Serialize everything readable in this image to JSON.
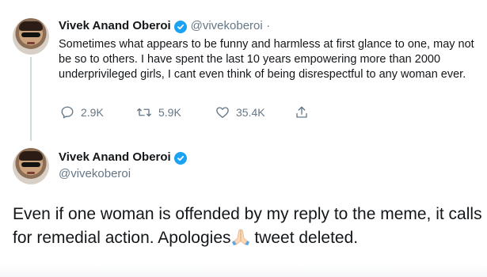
{
  "tweet1": {
    "name": "Vivek Anand Oberoi",
    "handle": "@vivekoberoi",
    "separator": "·",
    "text": "Sometimes what appears to be funny and harmless at first glance to one, may not be so to others. I have spent the last 10 years empowering more than 2000 underprivileged girls, I cant even think of being disrespectful to any woman ever.",
    "actions": {
      "reply_count": "2.9K",
      "retweet_count": "5.9K",
      "like_count": "35.4K"
    }
  },
  "tweet2": {
    "name": "Vivek Anand Oberoi",
    "handle": "@vivekoberoi",
    "text_before": "Even if one woman is offended by my reply to the meme, it calls for remedial action. Apologies",
    "text_after": " tweet deleted."
  },
  "icons": {
    "verified": "verified-badge-icon",
    "reply": "reply-icon",
    "retweet": "retweet-icon",
    "like": "heart-icon",
    "share": "share-icon",
    "emoji": "folded-hands-emoji"
  },
  "colors": {
    "accent": "#1da1f2",
    "muted": "#657786",
    "text": "#14171a",
    "thread_line": "#cfd9de"
  }
}
